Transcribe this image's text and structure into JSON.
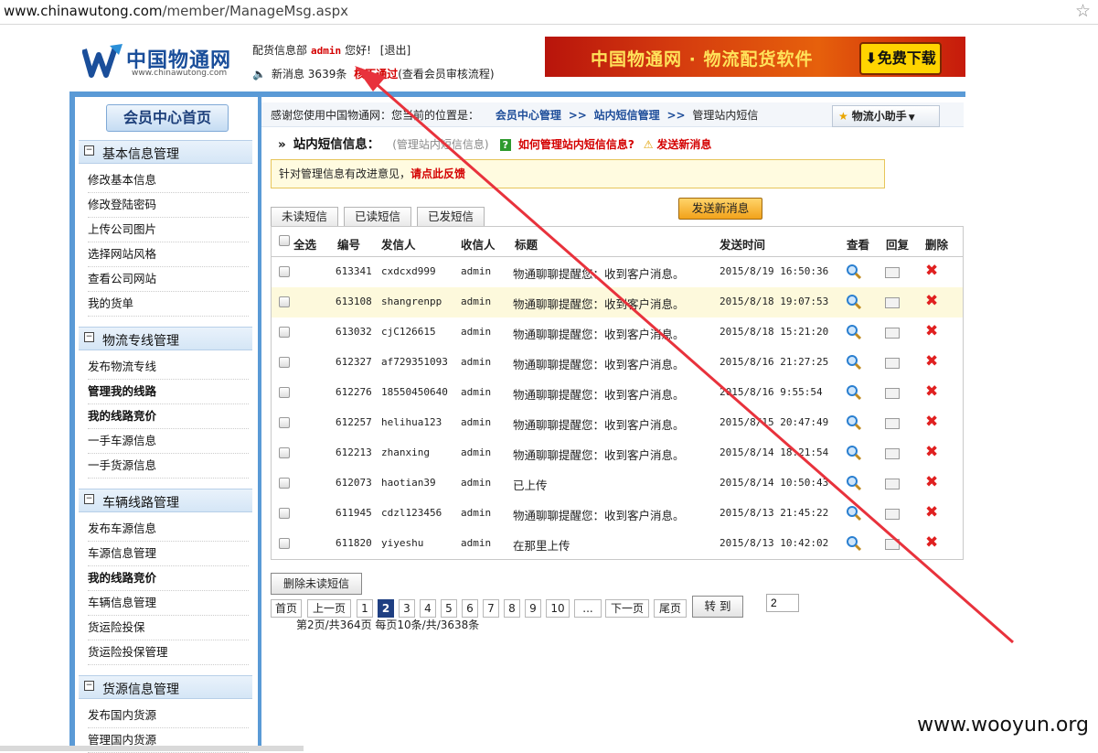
{
  "browser": {
    "url_domain": "www.chinawutong.com",
    "url_path": "/member/ManageMsg.aspx"
  },
  "header": {
    "logo_cn": "中国物通网",
    "logo_en": "www.chinawutong.com",
    "user_prefix": "配货信息部",
    "username": "admin",
    "greeting": "您好!",
    "logout": "[退出]",
    "new_msg_label": "新消息",
    "new_msg_count": "3639条",
    "audit_prefix": "核",
    "audit_status": "不通过",
    "audit_link": "(查看会员审核流程)",
    "banner_text": "中国物通网 · 物流配货软件",
    "banner_button": "免费下载"
  },
  "sidebar": {
    "home": "会员中心首页",
    "sections": [
      {
        "title": "基本信息管理",
        "items": [
          "修改基本信息",
          "修改登陆密码",
          "上传公司图片",
          "选择网站风格",
          "查看公司网站",
          "我的货单"
        ]
      },
      {
        "title": "物流专线管理",
        "items": [
          "发布物流专线",
          "管理我的线路",
          "我的线路竞价",
          "一手车源信息",
          "一手货源信息"
        ]
      },
      {
        "title": "车辆线路管理",
        "items": [
          "发布车源信息",
          "车源信息管理",
          "我的线路竞价",
          "车辆信息管理",
          "货运险投保",
          "货运险投保管理"
        ]
      },
      {
        "title": "货源信息管理",
        "items": [
          "发布国内货源",
          "管理国内货源"
        ]
      }
    ]
  },
  "crumb": {
    "prefix": "感谢您使用中国物通网：您当前的位置是：",
    "c1": "会员中心管理",
    "c2": "站内短信管理",
    "c3": "管理站内短信",
    "sep": ">>",
    "helper": "物流小助手"
  },
  "main": {
    "title": "站内短信信息：",
    "subtitle": "(管理站内短信信息)",
    "help_link": "如何管理站内短信信息?",
    "send_link": "发送新消息",
    "notice_prefix": "针对管理信息有改进意见，",
    "notice_link": "请点此反馈",
    "send_button": "发送新消息",
    "tabs": [
      "未读短信",
      "已读短信",
      "已发短信"
    ],
    "columns": [
      "全选",
      "编号",
      "发信人",
      "收信人",
      "标题",
      "发送时间",
      "查看",
      "回复",
      "删除"
    ],
    "rows": [
      {
        "id": "613341",
        "from": "cxdcxd999",
        "to": "admin",
        "title": "物通聊聊提醒您：收到客户消息。",
        "time": "2015/8/19 16:50:36"
      },
      {
        "id": "613108",
        "from": "shangrenpp",
        "to": "admin",
        "title": "物通聊聊提醒您：收到客户消息。",
        "time": "2015/8/18 19:07:53"
      },
      {
        "id": "613032",
        "from": "cjC126615",
        "to": "admin",
        "title": "物通聊聊提醒您：收到客户消息。",
        "time": "2015/8/18 15:21:20"
      },
      {
        "id": "612327",
        "from": "af729351093",
        "to": "admin",
        "title": "物通聊聊提醒您：收到客户消息。",
        "time": "2015/8/16 21:27:25"
      },
      {
        "id": "612276",
        "from": "18550450640",
        "to": "admin",
        "title": "物通聊聊提醒您：收到客户消息。",
        "time": "2015/8/16 9:55:54"
      },
      {
        "id": "612257",
        "from": "helihua123",
        "to": "admin",
        "title": "物通聊聊提醒您：收到客户消息。",
        "time": "2015/8/15 20:47:49"
      },
      {
        "id": "612213",
        "from": "zhanxing",
        "to": "admin",
        "title": "物通聊聊提醒您：收到客户消息。",
        "time": "2015/8/14 18:21:54"
      },
      {
        "id": "612073",
        "from": "haotian39",
        "to": "admin",
        "title": "已上传",
        "time": "2015/8/14 10:50:43"
      },
      {
        "id": "611945",
        "from": "cdzl123456",
        "to": "admin",
        "title": "物通聊聊提醒您：收到客户消息。",
        "time": "2015/8/13 21:45:22"
      },
      {
        "id": "611820",
        "from": "yiyeshu",
        "to": "admin",
        "title": "在那里上传",
        "time": "2015/8/13 10:42:02"
      }
    ],
    "delete_unread": "删除未读短信",
    "pager": {
      "first": "首页",
      "prev": "上一页",
      "pages": [
        "1",
        "2",
        "3",
        "4",
        "5",
        "6",
        "7",
        "8",
        "9",
        "10",
        "..."
      ],
      "next": "下一页",
      "last": "尾页",
      "goto": "转 到",
      "input_value": "2",
      "info": "第2页/共364页 每页10条/共/3638条"
    }
  },
  "watermark": "www.wooyun.org",
  "colors": {
    "accent_blue": "#5a9ad6",
    "link_blue": "#1f4e9a",
    "alert_red": "#d40000",
    "arrow_red": "#e8323c"
  }
}
